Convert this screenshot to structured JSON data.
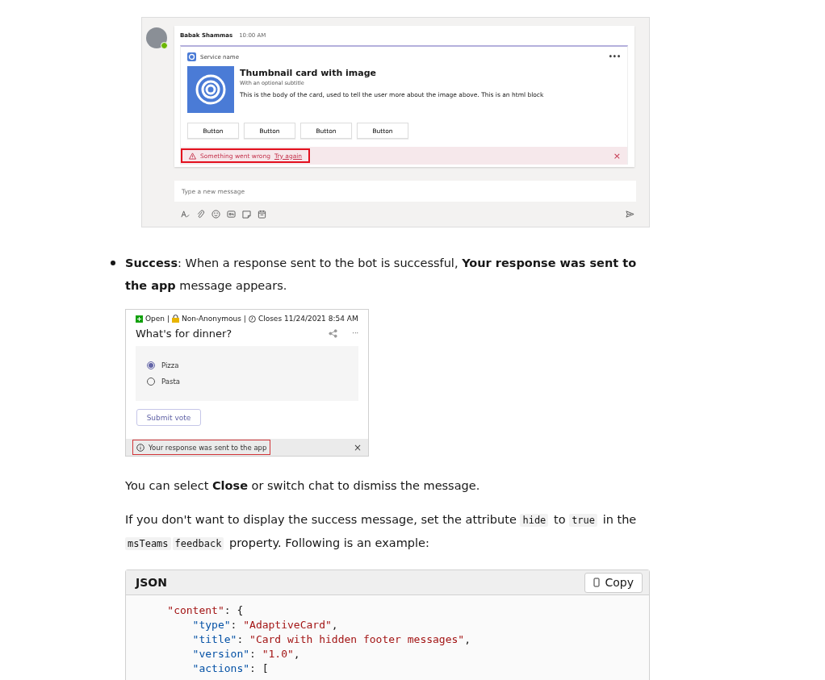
{
  "error_screenshot": {
    "sender": "Babak Shammas",
    "time": "10:00 AM",
    "service_name": "Service name",
    "menu": "•••",
    "card_title": "Thumbnail card with image",
    "card_subtitle": "With an optional subtitle",
    "card_body": "This is the body of the card, used to tell the user more about the image above. This is an html block",
    "buttons": [
      "Button",
      "Button",
      "Button",
      "Button"
    ],
    "error_text": "Something went wrong",
    "error_link": "Try again",
    "close": "×",
    "composer_placeholder": "Type a new message"
  },
  "bullets": [
    "**Success**: When a response sent to the bot is successful, **Your response was sent to the app** message appears."
  ],
  "poll_screenshot": {
    "status": "Open |",
    "privacy": "Non-Anonymous |",
    "closes": "Closes 11/24/2021 8:54 AM",
    "question": "What's for dinner?",
    "menu": "···",
    "options": [
      {
        "label": "Pizza",
        "selected": true
      },
      {
        "label": "Pasta",
        "selected": false
      }
    ],
    "submit": "Submit vote",
    "toast": "Your response was sent to the app",
    "close": "×"
  },
  "paragraphs": [
    [
      {
        "kind": "text",
        "text": "You can select **Close** or switch chat to dismiss the message."
      }
    ],
    [
      {
        "kind": "text",
        "text": "If you don't want to display the success message, set the attribute "
      },
      {
        "kind": "code",
        "text": "hide"
      },
      {
        "kind": "text",
        "text": " to "
      },
      {
        "kind": "code",
        "text": "true"
      },
      {
        "kind": "text",
        "text": " in the "
      },
      {
        "kind": "code",
        "text": "msTeams"
      },
      {
        "kind": "code",
        "text": "feedback"
      },
      {
        "kind": "text",
        "text": " property. Following is an example:"
      }
    ]
  ],
  "code_block": {
    "language": "JSON",
    "copy_label": "Copy",
    "lines": [
      [
        {
          "kind": "string",
          "text": "    \"content\""
        },
        {
          "kind": "plain",
          "text": ": {"
        }
      ],
      [
        {
          "kind": "key",
          "text": "        \"type\""
        },
        {
          "kind": "plain",
          "text": ": "
        },
        {
          "kind": "string",
          "text": "\"AdaptiveCard\""
        },
        {
          "kind": "plain",
          "text": ","
        }
      ],
      [
        {
          "kind": "key",
          "text": "        \"title\""
        },
        {
          "kind": "plain",
          "text": ": "
        },
        {
          "kind": "string",
          "text": "\"Card with hidden footer messages\""
        },
        {
          "kind": "plain",
          "text": ","
        }
      ],
      [
        {
          "kind": "key",
          "text": "        \"version\""
        },
        {
          "kind": "plain",
          "text": ": "
        },
        {
          "kind": "string",
          "text": "\"1.0\""
        },
        {
          "kind": "plain",
          "text": ","
        }
      ],
      [
        {
          "kind": "key",
          "text": "        \"actions\""
        },
        {
          "kind": "plain",
          "text": ": ["
        }
      ]
    ]
  }
}
